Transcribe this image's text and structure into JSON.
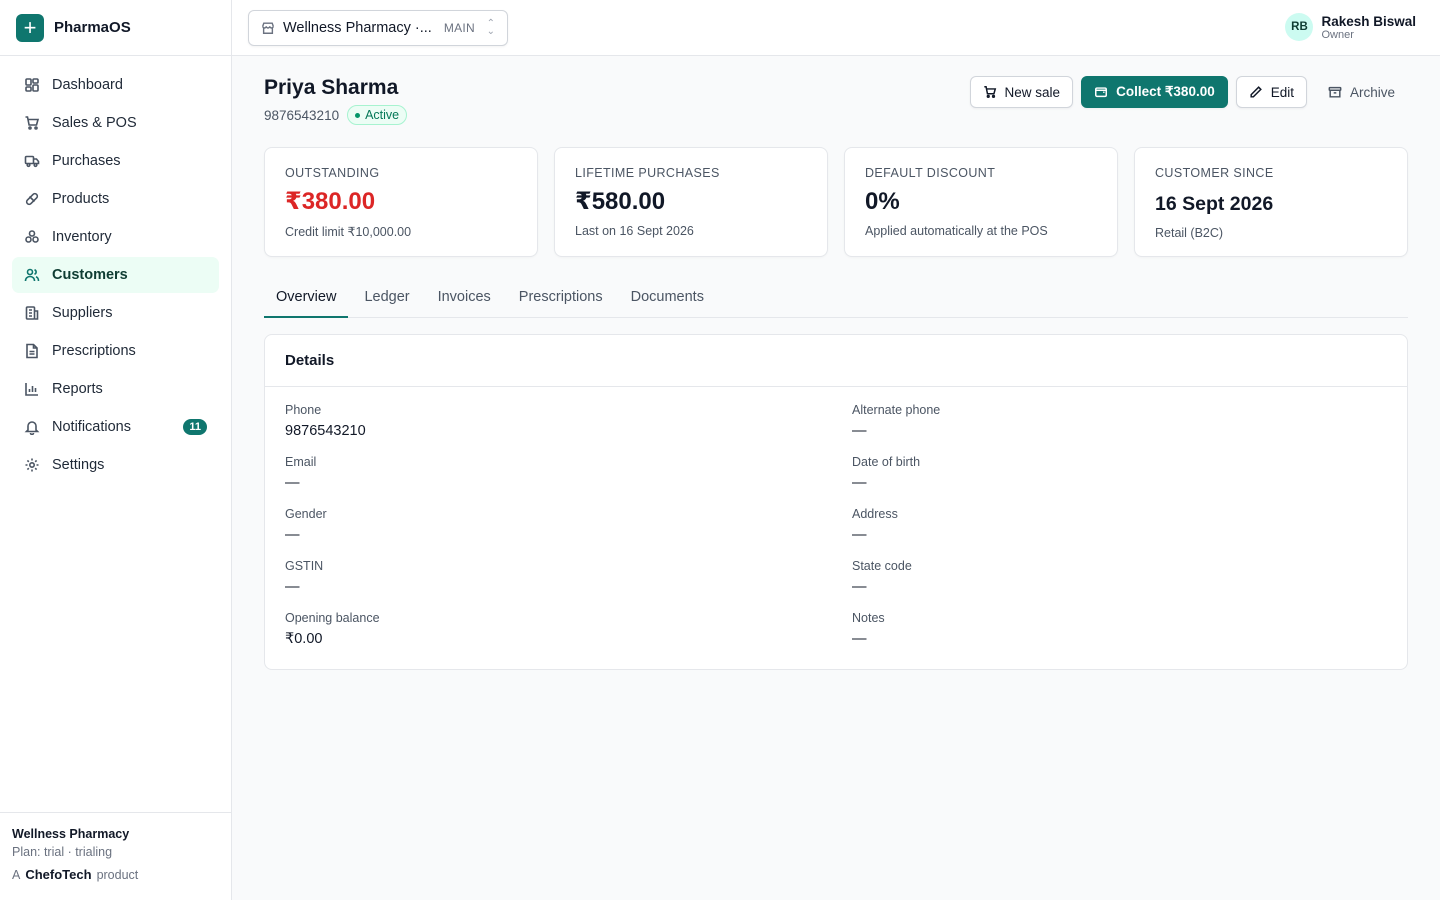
{
  "brand": {
    "name": "PharmaOS",
    "logo_symbol": "+"
  },
  "nav": [
    {
      "label": "Dashboard",
      "icon": "dashboard-icon",
      "active": false
    },
    {
      "label": "Sales & POS",
      "icon": "cart-icon",
      "active": false
    },
    {
      "label": "Purchases",
      "icon": "truck-icon",
      "active": false
    },
    {
      "label": "Products",
      "icon": "pill-icon",
      "active": false
    },
    {
      "label": "Inventory",
      "icon": "boxes-icon",
      "active": false
    },
    {
      "label": "Customers",
      "icon": "users-icon",
      "active": true
    },
    {
      "label": "Suppliers",
      "icon": "building-icon",
      "active": false
    },
    {
      "label": "Prescriptions",
      "icon": "file-icon",
      "active": false
    },
    {
      "label": "Reports",
      "icon": "chart-icon",
      "active": false
    },
    {
      "label": "Notifications",
      "icon": "bell-icon",
      "active": false,
      "badge": "11"
    },
    {
      "label": "Settings",
      "icon": "gear-icon",
      "active": false
    }
  ],
  "footer": {
    "store": "Wellness Pharmacy",
    "plan": "Plan: trial · trialing",
    "product_prefix": "A",
    "product_brand": "ChefoTech",
    "product_suffix": "product"
  },
  "topbar": {
    "store_name": "Wellness Pharmacy ·...",
    "store_tag": "MAIN",
    "user_initials": "RB",
    "user_name": "Rakesh Biswal",
    "user_role": "Owner"
  },
  "customer": {
    "name": "Priya Sharma",
    "phone": "9876543210",
    "status": "Active"
  },
  "actions": {
    "new_sale": "New sale",
    "collect": "Collect ₹380.00",
    "edit": "Edit",
    "archive": "Archive"
  },
  "stats": {
    "outstanding": {
      "label": "Outstanding",
      "value": "₹380.00",
      "hint": "Credit limit ₹10,000.00"
    },
    "lifetime": {
      "label": "Lifetime purchases",
      "value": "₹580.00",
      "hint": "Last on 16 Sept 2026"
    },
    "discount": {
      "label": "Default discount",
      "value": "0%",
      "hint": "Applied automatically at the POS"
    },
    "since": {
      "label": "Customer since",
      "value": "16 Sept 2026",
      "hint": "Retail (B2C)"
    }
  },
  "tabs": [
    "Overview",
    "Ledger",
    "Invoices",
    "Prescriptions",
    "Documents"
  ],
  "details": {
    "title": "Details",
    "phone_label": "Phone",
    "phone": "9876543210",
    "alt_phone_label": "Alternate phone",
    "alt_phone": "—",
    "email_label": "Email",
    "email": "—",
    "dob_label": "Date of birth",
    "dob": "—",
    "gender_label": "Gender",
    "gender": "—",
    "address_label": "Address",
    "address": "—",
    "gstin_label": "GSTIN",
    "gstin": "—",
    "state_label": "State code",
    "state": "—",
    "opening_label": "Opening balance",
    "opening": "₹0.00",
    "notes_label": "Notes",
    "notes": "—"
  },
  "colors": {
    "accent": "#0f766e",
    "danger": "#dc2626",
    "active_bg": "#ecfdf5"
  }
}
